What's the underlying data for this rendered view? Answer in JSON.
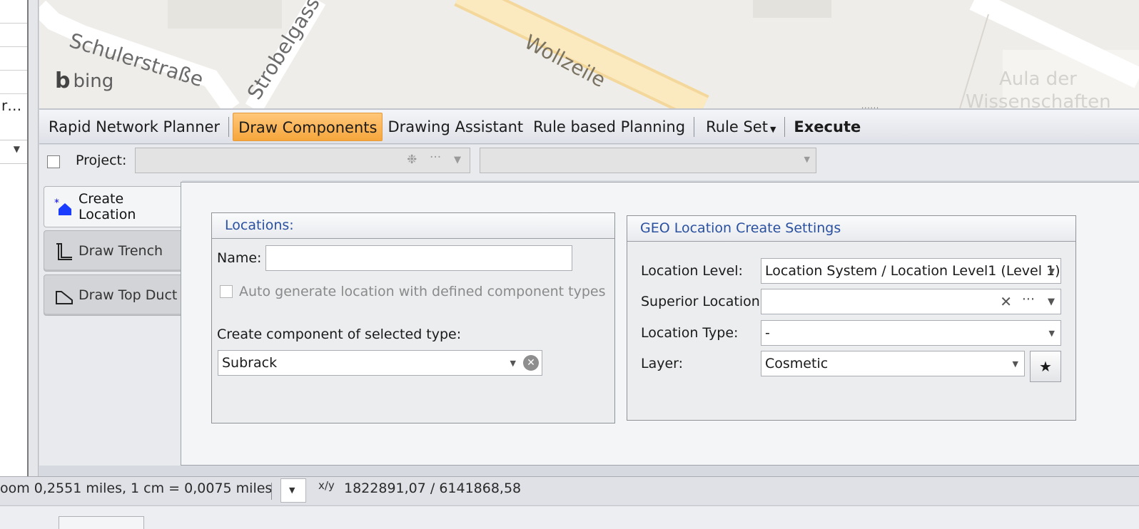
{
  "left_panel": {
    "truncated_text": "r…"
  },
  "map": {
    "streets": [
      "Schulerstraße",
      "Strobelgass",
      "Wollzeile",
      "Aula der",
      "Wissenschaften"
    ],
    "logo_text": "bing"
  },
  "toolbar": {
    "items": [
      {
        "label": "Rapid Network Planner"
      },
      {
        "label": "Draw Components"
      },
      {
        "label": "Drawing Assistant"
      },
      {
        "label": "Rule based Planning"
      },
      {
        "label": "Rule Set"
      },
      {
        "label": "Execute"
      }
    ]
  },
  "project_bar": {
    "label": "Project:",
    "value": "",
    "secondary_value": ""
  },
  "tabs": [
    {
      "label": "Create Location",
      "icon": "create-location-icon",
      "active": true
    },
    {
      "label": "Draw Trench",
      "icon": "trench-icon",
      "active": false
    },
    {
      "label": "Draw Top Duct",
      "icon": "top-duct-icon",
      "active": false
    }
  ],
  "locations_group": {
    "title": "Locations:",
    "name_label": "Name:",
    "name_value": "",
    "auto_generate_label": "Auto generate location with defined component types",
    "component_type_label": "Create component of selected type:",
    "component_type_value": "Subrack"
  },
  "geo_group": {
    "title": "GEO Location Create Settings",
    "location_level_label": "Location Level:",
    "location_level_value": "Location System / Location Level1 (Level 1)",
    "superior_location_label": "Superior Location:",
    "superior_location_value": "",
    "location_type_label": "Location Type:",
    "location_type_value": "-",
    "layer_label": "Layer:",
    "layer_value": "Cosmetic"
  },
  "status_bar": {
    "scale_text": "oom 0,2551 miles, 1 cm = 0,0075 miles",
    "xy_label": "x/y",
    "coordinates": "1822891,07 / 6141868,58"
  }
}
